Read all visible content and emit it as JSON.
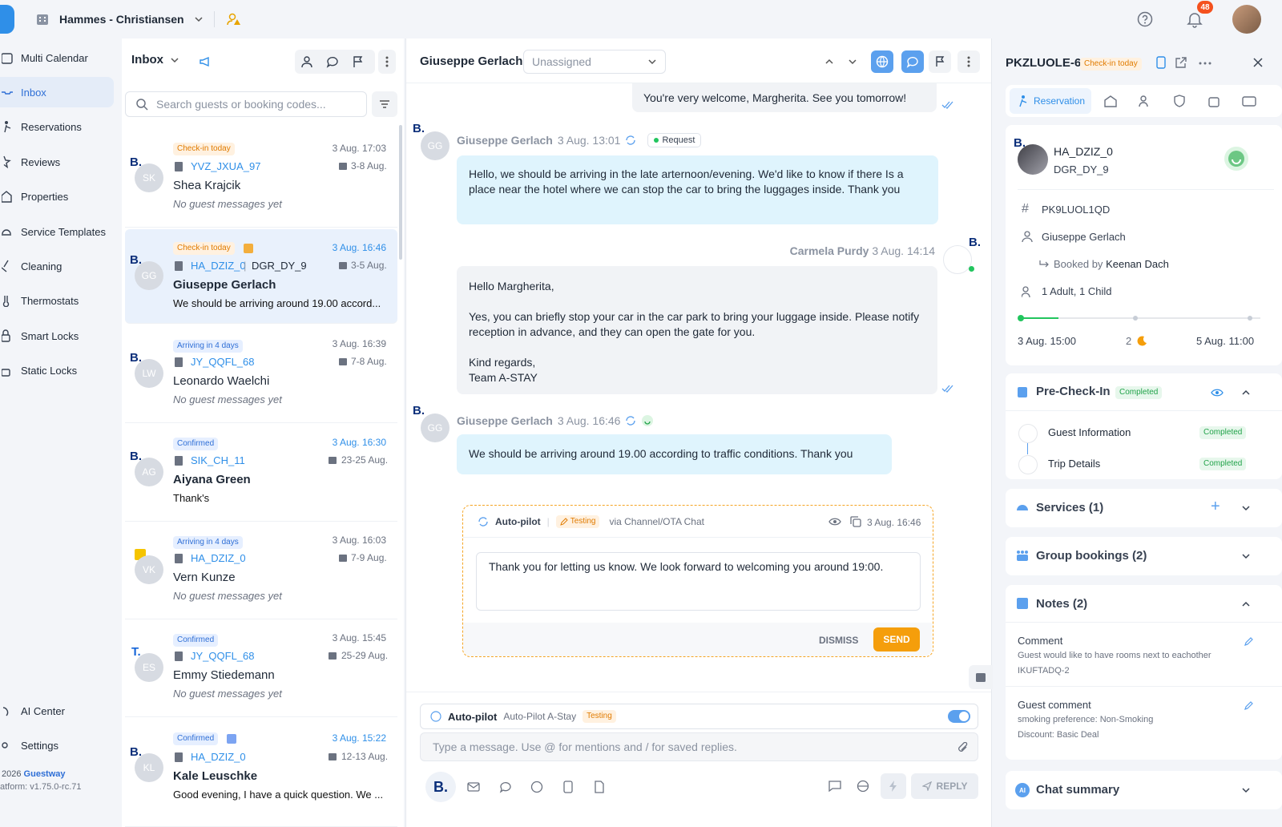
{
  "topbar": {
    "org_name": "Hammes - Christiansen",
    "notification_count": "48"
  },
  "sidebar": {
    "items": [
      {
        "label": "Multi Calendar"
      },
      {
        "label": "Inbox"
      },
      {
        "label": "Reservations"
      },
      {
        "label": "Reviews"
      },
      {
        "label": "Properties"
      },
      {
        "label": "Service Templates"
      },
      {
        "label": "Cleaning"
      },
      {
        "label": "Thermostats"
      },
      {
        "label": "Smart Locks"
      },
      {
        "label": "Static Locks"
      }
    ],
    "ai_center": "AI Center",
    "settings": "Settings",
    "copyright_year": "2026",
    "brand": "Guestway",
    "version": "atform: v1.75.0-rc.71"
  },
  "inbox": {
    "title": "Inbox",
    "search_placeholder": "Search guests or booking codes...",
    "conversations": [
      {
        "badge": "Check-in today",
        "code": "YVZ_JXUA_97",
        "time": "3 Aug. 17:03",
        "dates": "3-8 Aug.",
        "initials": "SK",
        "name": "Shea Krajcik",
        "preview": "No guest messages yet",
        "channel": "B."
      },
      {
        "badge": "Check-in today",
        "code": "HA_DZIZ_0",
        "code2": "DGR_DY_9",
        "time": "3 Aug. 16:46",
        "dates": "3-5 Aug.",
        "initials": "GG",
        "name": "Giuseppe Gerlach",
        "preview": "We should be arriving around 19.00 accord...",
        "channel": "B."
      },
      {
        "badge": "Arriving in 4 days",
        "code": "JY_QQFL_68",
        "time": "3 Aug. 16:39",
        "dates": "7-8 Aug.",
        "initials": "LW",
        "name": "Leonardo Waelchi",
        "preview": "No guest messages yet",
        "channel": "B."
      },
      {
        "badge": "Confirmed",
        "code": "SIK_CH_11",
        "time": "3 Aug. 16:30",
        "dates": "23-25 Aug.",
        "initials": "AG",
        "name": "Aiyana Green",
        "preview": "Thank's",
        "channel": "B."
      },
      {
        "badge": "Arriving in 4 days",
        "code": "HA_DZIZ_0",
        "time": "3 Aug. 16:03",
        "dates": "7-9 Aug.",
        "initials": "VK",
        "name": "Vern Kunze",
        "preview": "No guest messages yet",
        "channel": ""
      },
      {
        "badge": "Confirmed",
        "code": "JY_QQFL_68",
        "time": "3 Aug. 15:45",
        "dates": "25-29 Aug.",
        "initials": "ES",
        "name": "Emmy Stiedemann",
        "preview": "No guest messages yet",
        "channel": "T."
      },
      {
        "badge": "Confirmed",
        "code": "HA_DZIZ_0",
        "time": "3 Aug. 15:22",
        "dates": "12-13 Aug.",
        "initials": "KL",
        "name": "Kale Leuschke",
        "preview": "Good evening, I have a quick question. We ...",
        "channel": "B."
      }
    ]
  },
  "chat": {
    "guest_name": "Giuseppe Gerlach",
    "assignee": "Unassigned",
    "msg0": "You're very welcome, Margherita. See you tomorrow!",
    "msg1": {
      "sender": "Giuseppe Gerlach",
      "time": "3 Aug. 13:01",
      "tag": "Request",
      "text": "Hello, we should be arriving in the late arternoon/evening. We'd like to know if there Is a place near the hotel where we can stop the car to bring the luggages inside. Thank you"
    },
    "msg2": {
      "sender": "Carmela Purdy",
      "time": "3 Aug. 14:14",
      "l1": "Hello Margherita,",
      "l2": "Yes, you can briefly stop your car in the car park to bring your luggage inside. Please notify reception in advance, and they can open the gate for you.",
      "l3": "Kind regards,",
      "l4": "Team A-STAY"
    },
    "msg3": {
      "sender": "Giuseppe Gerlach",
      "time": "3 Aug. 16:46",
      "text": "We should be arriving around 19.00 according to traffic conditions. Thank you"
    },
    "autopilot": {
      "label": "Auto-pilot",
      "mode": "Testing",
      "via": "via Channel/OTA Chat",
      "time": "3 Aug. 16:46",
      "draft": "Thank you for letting us know. We look forward to welcoming you around 19:00.",
      "dismiss": "DISMISS",
      "send": "SEND"
    },
    "composer": {
      "autopilot_label": "Auto-pilot",
      "autopilot_name": "Auto-Pilot A-Stay",
      "mode": "Testing",
      "placeholder": "Type a message. Use @ for mentions and / for saved replies.",
      "reply": "REPLY"
    }
  },
  "details": {
    "code": "PKZLUOLE-6",
    "badge": "Check-in today",
    "tab": "Reservation",
    "unit": "HA_DZIZ_0",
    "unit_sub": "DGR_DY_9",
    "booking_id": "PK9LUOL1QD",
    "guest": "Giuseppe Gerlach",
    "booked_by_prefix": "Booked by",
    "booked_by": "Keenan Dach",
    "occupancy": "1 Adult, 1 Child",
    "checkin": "3 Aug. 15:00",
    "nights": "2",
    "checkout": "5 Aug. 11:00",
    "precheckin": {
      "title": "Pre-Check-In",
      "status": "Completed",
      "items": [
        {
          "label": "Guest Information",
          "status": "Completed"
        },
        {
          "label": "Trip Details",
          "status": "Completed"
        }
      ]
    },
    "services": "Services (1)",
    "group": "Group bookings (2)",
    "notes": "Notes (2)",
    "note1": {
      "title": "Comment",
      "l1": "Guest would like to have rooms next to eachother",
      "l2": "IKUFTADQ-2"
    },
    "note2": {
      "title": "Guest comment",
      "l1": "smoking preference: Non-Smoking",
      "l2": "Discount: Basic Deal"
    },
    "summary": "Chat summary"
  }
}
